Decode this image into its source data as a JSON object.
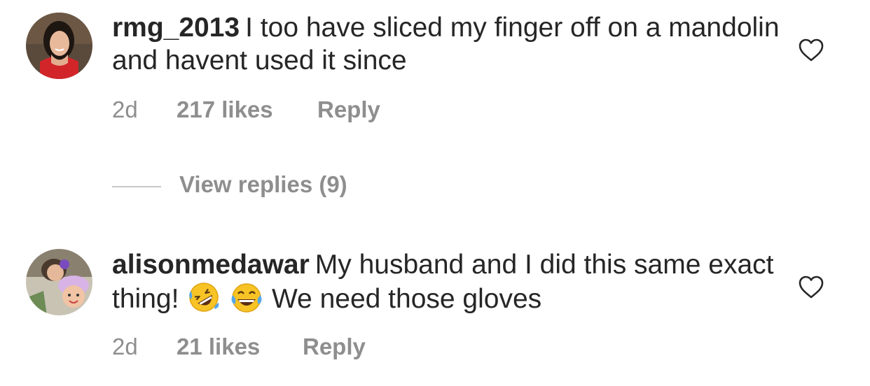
{
  "comments": [
    {
      "username": "rmg_2013",
      "text": "I too have sliced my finger off on a mandolin and havent used it since",
      "time": "2d",
      "likes": "217 likes",
      "reply_label": "Reply"
    },
    {
      "username": "alisonmedawar",
      "text_before": "My husband and I did this same exact thing!",
      "emojis": [
        "rolling-on-floor-laughing",
        "face-with-tears-of-joy"
      ],
      "text_after": "We need those gloves",
      "time": "2d",
      "likes": "21 likes",
      "reply_label": "Reply"
    }
  ],
  "view_replies": {
    "label": "View replies (9)"
  },
  "icons": {
    "like": "heart-outline-icon"
  },
  "colors": {
    "text": "#262626",
    "secondary": "#8e8e8e",
    "divider": "#c7c7c7"
  }
}
